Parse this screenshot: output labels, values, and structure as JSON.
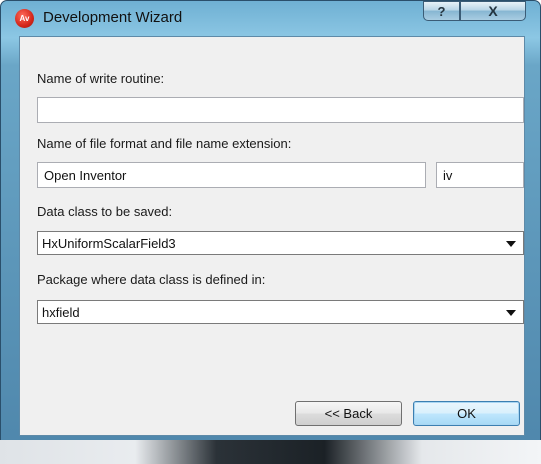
{
  "window": {
    "title": "Development Wizard",
    "app_icon_text": "Av",
    "help_label": "?",
    "close_label": "X"
  },
  "form": {
    "write_routine_label": "Name of write routine:",
    "write_routine_value": "",
    "file_format_label": "Name of file format and file name extension:",
    "file_format_value": "Open Inventor",
    "extension_value": "iv",
    "data_class_label": "Data class to be saved:",
    "data_class_value": "HxUniformScalarField3",
    "package_label": "Package where data class is defined in:",
    "package_value": "hxfield"
  },
  "buttons": {
    "back_label": "<< Back",
    "ok_label": "OK"
  }
}
